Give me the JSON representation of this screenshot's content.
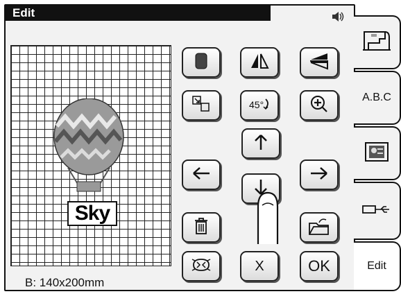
{
  "title": "Edit",
  "size_info": "B: 140x200mm",
  "design_text": "Sky",
  "buttons": {
    "cancel_label": "X",
    "ok_label": "OK"
  },
  "tabs": {
    "abc_label": "A.B.C",
    "edit_label": "Edit"
  },
  "icons": [
    "speaker-icon",
    "sewing-machine-icon",
    "memory-card-icon",
    "usb-icon",
    "density-icon",
    "mirror-horizontal-icon",
    "mirror-vertical-icon",
    "resize-icon",
    "rotate-45-icon",
    "zoom-icon",
    "arrow-up-icon",
    "arrow-left-icon",
    "arrow-right-icon",
    "arrow-down-icon",
    "delete-icon",
    "open-folder-icon",
    "thread-color-icon"
  ],
  "colors": {
    "title_bar": "#111111",
    "screen_bg": "#f2f2f2"
  }
}
